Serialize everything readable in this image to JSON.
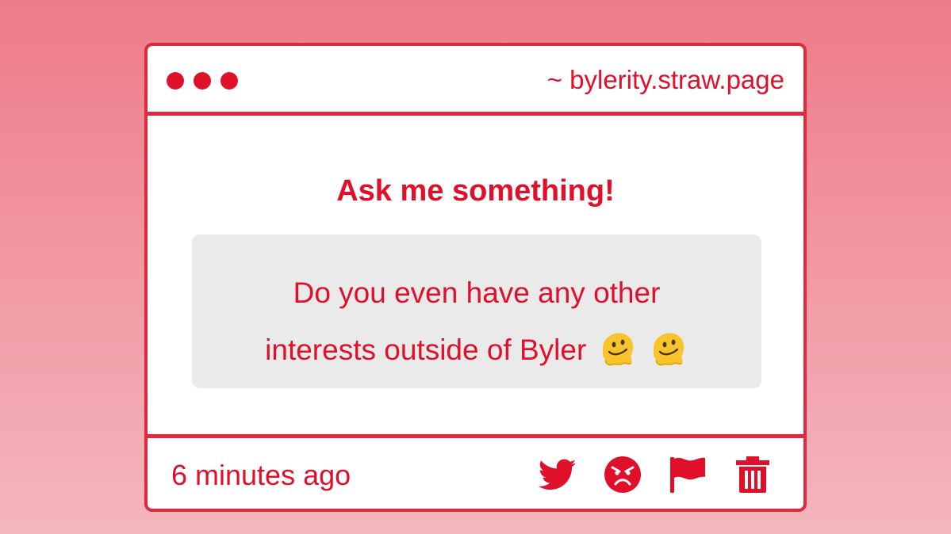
{
  "window": {
    "dots": [
      "close-dot",
      "minimize-dot",
      "maximize-dot"
    ],
    "url": "~ bylerity.straw.page"
  },
  "content": {
    "heading": "Ask me something!",
    "question_line1": "Do you even have any other",
    "question_line2": "interests outside of Byler",
    "emoji": "melting-face-emoji"
  },
  "footer": {
    "timestamp": "6 minutes ago",
    "actions": [
      "twitter-icon",
      "angry-face-icon",
      "flag-icon",
      "trash-icon"
    ]
  },
  "colors": {
    "accent": "#e0102b",
    "border": "#e0283f",
    "bubble": "#eaeaeb",
    "background_top": "#ee7a88",
    "background_bottom": "#f4b6bd"
  }
}
